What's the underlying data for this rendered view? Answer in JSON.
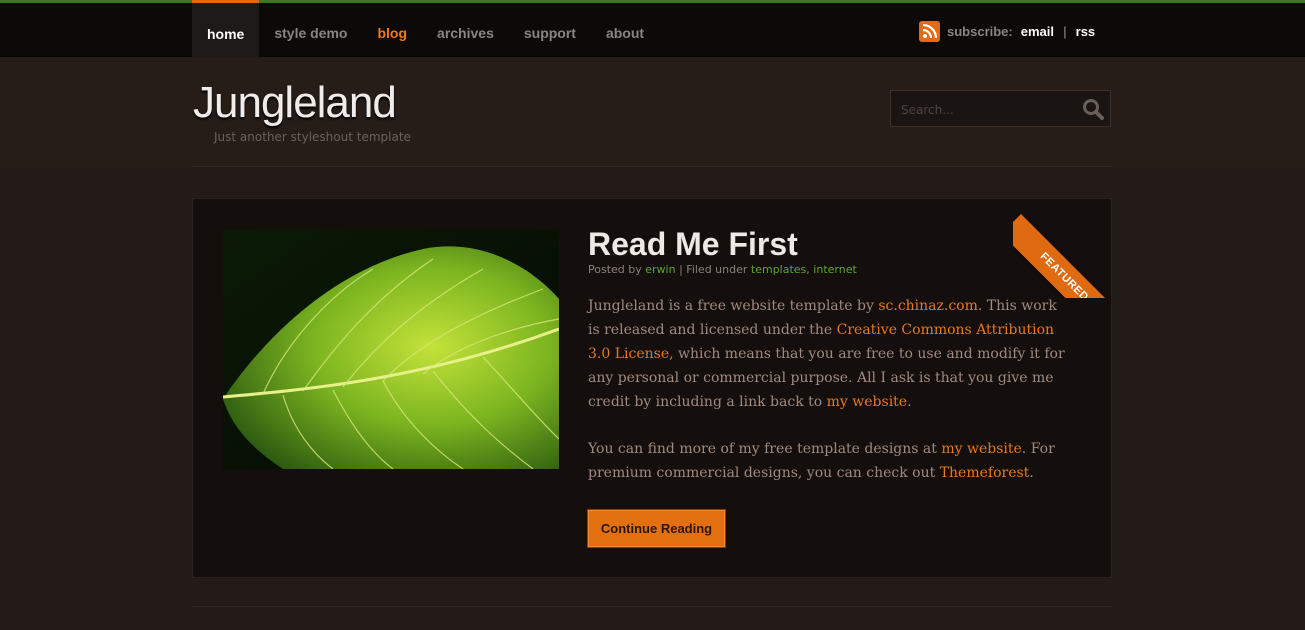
{
  "nav": {
    "items": [
      {
        "label": "home",
        "state": "active"
      },
      {
        "label": "style demo",
        "state": ""
      },
      {
        "label": "blog",
        "state": "highlight"
      },
      {
        "label": "archives",
        "state": ""
      },
      {
        "label": "support",
        "state": ""
      },
      {
        "label": "about",
        "state": ""
      }
    ]
  },
  "subscribe": {
    "label": "subscribe:",
    "email": "email",
    "separator": "|",
    "rss": "rss"
  },
  "header": {
    "title": "Jungleland",
    "tagline": "Just another styleshout template"
  },
  "search": {
    "placeholder": "Search..."
  },
  "post": {
    "ribbon": "FEATURED",
    "title": "Read Me First",
    "meta": {
      "posted_by": "Posted by",
      "author": "erwin",
      "filed": "| Filed under",
      "cat1": "templates",
      "comma": ",",
      "cat2": "internet"
    },
    "p1": {
      "t1": "Jungleland is a free website template by ",
      "l1": "sc.chinaz.com",
      "t2": ". This work is released and licensed under the ",
      "l2": "Creative Commons Attribution 3.0 License",
      "t3": ", which means that you are free to use and modify it for any personal or commercial purpose. All I ask is that you give me credit by including a link back to ",
      "l3": "my website",
      "t4": "."
    },
    "p2": {
      "t1": "You can find more of my free template designs at ",
      "l1": "my website",
      "t2": ". For premium commercial designs, you can check out ",
      "l2": "Themeforest",
      "t3": "."
    },
    "button": "Continue Reading"
  },
  "colors": {
    "accent": "#e06a10",
    "link_green": "#5ca632",
    "top_border": "#3c7a20",
    "background": "#231b17"
  },
  "icons": [
    "rss-icon",
    "search-icon"
  ]
}
